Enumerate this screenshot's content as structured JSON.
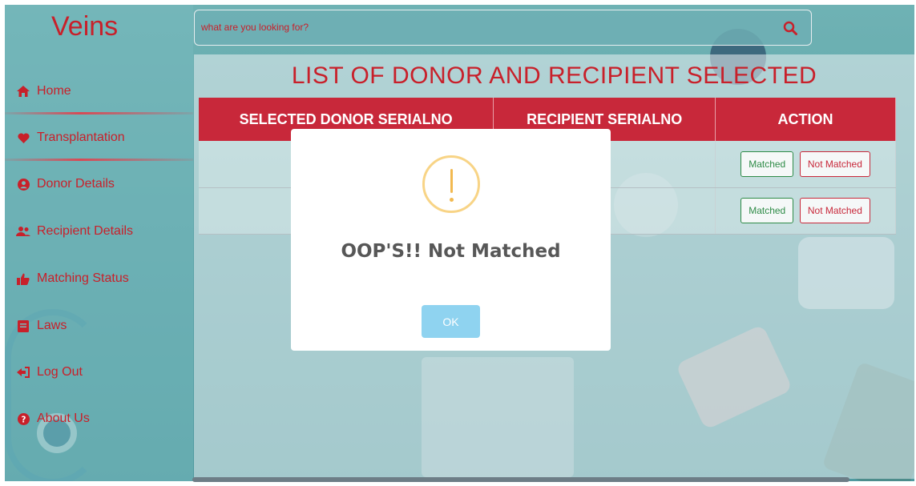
{
  "app": {
    "logo": "Veins"
  },
  "search": {
    "placeholder": "what are you looking for?",
    "icon": "search-icon"
  },
  "sidebar": {
    "items": [
      {
        "label": "Home",
        "icon": "home-icon"
      },
      {
        "label": "Transplantation",
        "icon": "heart-icon"
      },
      {
        "label": "Donor Details",
        "icon": "user-circle-icon"
      },
      {
        "label": "Recipient Details",
        "icon": "users-icon"
      },
      {
        "label": "Matching Status",
        "icon": "thumbs-up-icon"
      },
      {
        "label": "Laws",
        "icon": "document-icon"
      },
      {
        "label": "Log Out",
        "icon": "sign-out-icon"
      },
      {
        "label": "About Us",
        "icon": "question-circle-icon"
      }
    ]
  },
  "main": {
    "title": "LIST OF DONOR AND RECIPIENT SELECTED",
    "columns": [
      "SELECTED DONOR SERIALNO",
      "RECIPIENT SERIALNO",
      "ACTION"
    ],
    "rows": [
      {
        "donor": "",
        "recipient": "",
        "matched_label": "Matched",
        "not_matched_label": "Not Matched"
      },
      {
        "donor": "",
        "recipient": "",
        "matched_label": "Matched",
        "not_matched_label": "Not Matched"
      }
    ]
  },
  "modal": {
    "title": "OOP'S!! Not Matched",
    "ok_label": "OK",
    "icon": "warning-icon"
  },
  "colors": {
    "brand_red": "#c8202a",
    "header_red": "#c8283a",
    "ok_blue": "#8fd3f0",
    "warning": "#f8d486",
    "match_green": "#2e8b47"
  }
}
